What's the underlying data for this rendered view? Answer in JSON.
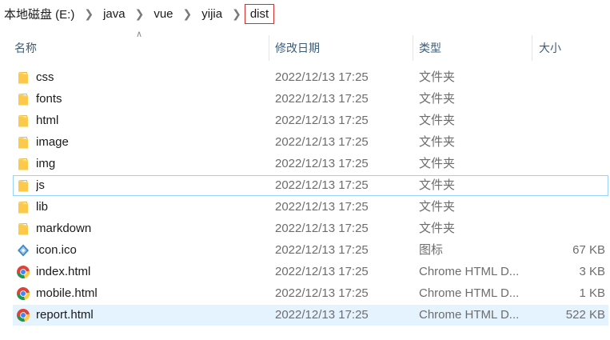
{
  "breadcrumb": [
    "本地磁盘 (E:)",
    "java",
    "vue",
    "yijia",
    "dist"
  ],
  "columns": {
    "name": "名称",
    "date": "修改日期",
    "type": "类型",
    "size": "大小"
  },
  "files": [
    {
      "name": "css",
      "date": "2022/12/13 17:25",
      "type": "文件夹",
      "size": "",
      "icon": "folder-icon"
    },
    {
      "name": "fonts",
      "date": "2022/12/13 17:25",
      "type": "文件夹",
      "size": "",
      "icon": "folder-icon"
    },
    {
      "name": "html",
      "date": "2022/12/13 17:25",
      "type": "文件夹",
      "size": "",
      "icon": "folder-icon"
    },
    {
      "name": "image",
      "date": "2022/12/13 17:25",
      "type": "文件夹",
      "size": "",
      "icon": "folder-icon"
    },
    {
      "name": "img",
      "date": "2022/12/13 17:25",
      "type": "文件夹",
      "size": "",
      "icon": "folder-icon"
    },
    {
      "name": "js",
      "date": "2022/12/13 17:25",
      "type": "文件夹",
      "size": "",
      "icon": "folder-icon"
    },
    {
      "name": "lib",
      "date": "2022/12/13 17:25",
      "type": "文件夹",
      "size": "",
      "icon": "folder-icon"
    },
    {
      "name": "markdown",
      "date": "2022/12/13 17:25",
      "type": "文件夹",
      "size": "",
      "icon": "folder-icon"
    },
    {
      "name": "icon.ico",
      "date": "2022/12/13 17:25",
      "type": "图标",
      "size": "67 KB",
      "icon": "image-file-icon"
    },
    {
      "name": "index.html",
      "date": "2022/12/13 17:25",
      "type": "Chrome HTML D...",
      "size": "3 KB",
      "icon": "chrome-icon"
    },
    {
      "name": "mobile.html",
      "date": "2022/12/13 17:25",
      "type": "Chrome HTML D...",
      "size": "1 KB",
      "icon": "chrome-icon"
    },
    {
      "name": "report.html",
      "date": "2022/12/13 17:25",
      "type": "Chrome HTML D...",
      "size": "522 KB",
      "icon": "chrome-icon"
    }
  ],
  "state": {
    "focused_item": "js",
    "selected_item": "report.html",
    "sort_column": "name",
    "sort_direction": "ascending"
  },
  "colors": {
    "highlight_border": "#d32f2f",
    "selection_background": "#e5f3ff",
    "focus_border": "#99d1ff",
    "header_text": "#3b5d7a"
  }
}
